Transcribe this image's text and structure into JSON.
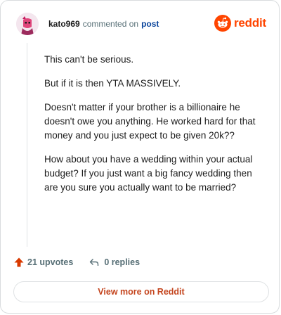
{
  "header": {
    "username": "kato969",
    "action_text": "commented on",
    "post_link": "post",
    "logo_text": "reddit"
  },
  "comment": {
    "paragraphs": [
      "This can't be serious.",
      "But if it is then YTA MASSIVELY.",
      "Doesn't matter if your brother is a billionaire he doesn't owe you anything. He worked hard for that money and you just expect to be given 20k??",
      "How about you have a wedding within your actual budget? If you just want a big fancy wedding then are you sure you actually want to be married?"
    ]
  },
  "footer": {
    "upvotes_label": "21 upvotes",
    "replies_label": "0 replies"
  },
  "view_more": {
    "label": "View more on Reddit"
  },
  "colors": {
    "brand": "#ff4500",
    "link": "#0a449b",
    "muted": "#576f76"
  },
  "icons": {
    "upvote": "upvote-arrow-icon",
    "reply": "reply-arrow-icon",
    "logo": "reddit-snoo-icon"
  }
}
